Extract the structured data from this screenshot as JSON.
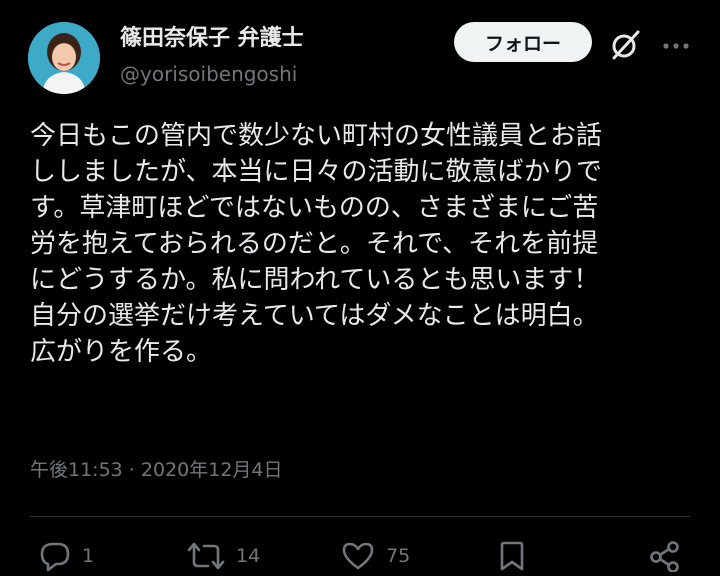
{
  "header": {
    "display_name": "篠田奈保子 弁護士",
    "handle": "@yorisoibengoshi",
    "follow_label": "フォロー"
  },
  "tweet": {
    "lines": [
      "今日もこの管内で数少ない町村の女性議員とお話",
      "ししましたが、本当に日々の活動に敬意ばかりで",
      "す。草津町ほどではないものの、さまざまにご苦",
      "労を抱えておられるのだと。それで、それを前提",
      "にどうするか。私に問われているとも思います！",
      "自分の選挙だけ考えていてはダメなことは明白。",
      "広がりを作る。"
    ],
    "timestamp": "午後11:53 · 2020年12月4日"
  },
  "actions": {
    "reply_count": "1",
    "retweet_count": "14",
    "like_count": "75"
  },
  "colors": {
    "background": "#000000",
    "text": "#e7e9ea",
    "muted": "#71767b",
    "follow_bg": "#eff3f4"
  }
}
